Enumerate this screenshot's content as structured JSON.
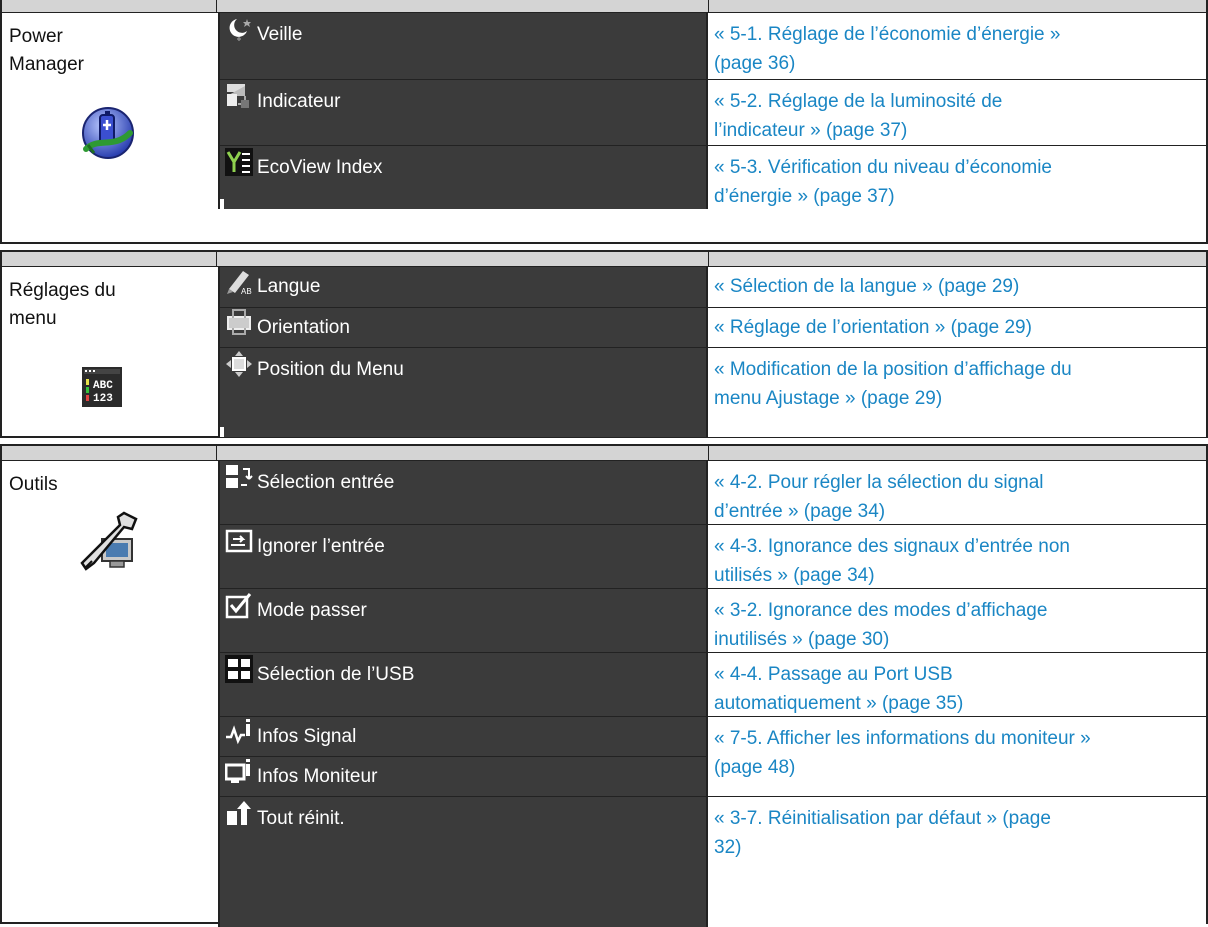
{
  "sections": [
    {
      "category_lines": [
        "Power",
        "Manager"
      ],
      "category_icon": "power-manager-icon",
      "rows": [
        {
          "icon": "moon-sleep-icon",
          "label": "Veille",
          "link_lines": [
            "« 5-1. Réglage de l’économie d’énergie »",
            "(page 36)"
          ]
        },
        {
          "icon": "indicator-light-icon",
          "label": "Indicateur",
          "link_lines": [
            "« 5-2. Réglage de la luminosité de",
            "l’indicateur » (page 37)"
          ]
        },
        {
          "icon": "ecoview-index-icon",
          "label": "EcoView Index",
          "link_lines": [
            "« 5-3. Vérification du niveau d’économie",
            "d’énergie » (page 37)"
          ]
        }
      ]
    },
    {
      "category_lines": [
        "Réglages du",
        "menu"
      ],
      "category_icon": "abc-123-menu-icon",
      "rows": [
        {
          "icon": "language-pen-icon",
          "label": "Langue",
          "link_lines": [
            "« Sélection de la langue » (page 29)"
          ]
        },
        {
          "icon": "orientation-icon",
          "label": "Orientation",
          "link_lines": [
            "« Réglage de l’orientation » (page 29)"
          ]
        },
        {
          "icon": "menu-position-icon",
          "label": "Position du Menu",
          "link_lines": [
            "« Modification de la position d’affichage du",
            "menu Ajustage » (page 29)"
          ]
        }
      ]
    },
    {
      "category_lines": [
        "Outils"
      ],
      "category_icon": "wrench-tools-icon",
      "rows": [
        {
          "icon": "input-select-icon",
          "label": "Sélection entrée",
          "link_lines": [
            "« 4-2. Pour régler la sélection du signal",
            "d’entrée » (page 34)"
          ]
        },
        {
          "icon": "input-skip-icon",
          "label": "Ignorer l’entrée",
          "link_lines": [
            "« 4-3. Ignorance des signaux d’entrée non",
            "utilisés » (page 34)"
          ]
        },
        {
          "icon": "checkbox-mode-icon",
          "label": "Mode passer",
          "link_lines": [
            "« 3-2. Ignorance des modes d’affichage",
            "inutilisés » (page 30)"
          ]
        },
        {
          "icon": "usb-select-icon",
          "label": "Sélection de l’USB",
          "link_lines": [
            "« 4-4. Passage au Port USB",
            "automatiquement » (page 35)"
          ]
        },
        {
          "icon": "signal-info-icon",
          "label": "Infos Signal",
          "link_lines": []
        },
        {
          "icon": "monitor-info-icon",
          "label": "Infos Moniteur",
          "link_lines": []
        },
        {
          "icon": "reset-all-icon",
          "label": "Tout réinit.",
          "link_lines": [
            "« 3-7. Réinitialisation par défaut » (page",
            "32)"
          ]
        }
      ],
      "merged_link_lines": [
        "« 7-5. Afficher les informations du moniteur »",
        "(page 48)"
      ]
    }
  ]
}
